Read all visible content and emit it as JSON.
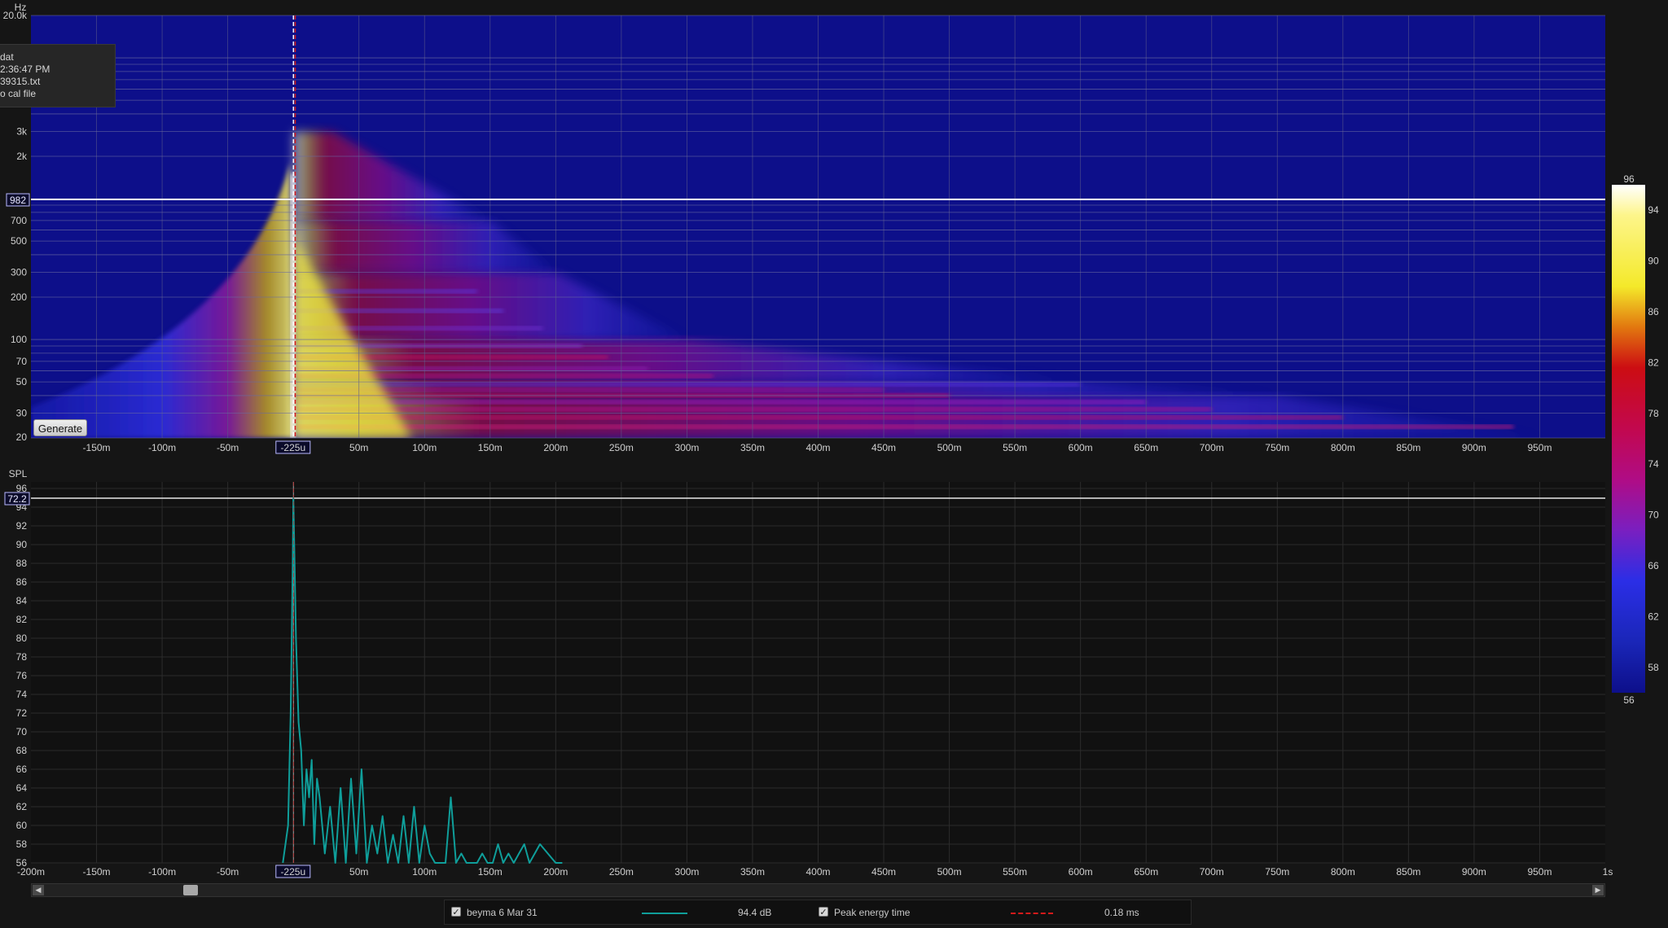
{
  "spectrogram": {
    "unit_label": "Hz",
    "freq_ticks": [
      "20.0k",
      "3k",
      "2k",
      "700",
      "500",
      "300",
      "200",
      "100",
      "70",
      "50",
      "30",
      "20"
    ],
    "freq_ticks_hz": [
      20000,
      3000,
      2000,
      700,
      500,
      300,
      200,
      100,
      70,
      50,
      30,
      20
    ],
    "cursor_freq_label": "982",
    "cursor_freq_hz": 982,
    "time_ticks": [
      "-150m",
      "-100m",
      "-50m",
      "-225u",
      "50m",
      "100m",
      "150m",
      "200m",
      "250m",
      "300m",
      "350m",
      "400m",
      "450m",
      "500m",
      "550m",
      "600m",
      "650m",
      "700m",
      "750m",
      "800m",
      "850m",
      "900m",
      "950m"
    ],
    "time_ticks_s": [
      -0.15,
      -0.1,
      -0.05,
      -0.000225,
      0.05,
      0.1,
      0.15,
      0.2,
      0.25,
      0.3,
      0.35,
      0.4,
      0.45,
      0.5,
      0.55,
      0.6,
      0.65,
      0.7,
      0.75,
      0.8,
      0.85,
      0.9,
      0.95
    ],
    "time_range_s": [
      -0.2,
      1.0
    ],
    "freq_range_hz": [
      20,
      20000
    ],
    "generate_label": "Generate"
  },
  "info_box": {
    "lines": [
      "dat",
      "2:36:47 PM",
      "39315.txt",
      "o cal file"
    ]
  },
  "colorbar": {
    "labels": [
      "96",
      "94",
      "90",
      "86",
      "82",
      "78",
      "74",
      "70",
      "66",
      "62",
      "58",
      "56"
    ],
    "values": [
      96,
      94,
      90,
      86,
      82,
      78,
      74,
      70,
      66,
      62,
      58,
      56
    ],
    "colors": [
      "#ffffff",
      "#fdf58a",
      "#f4e92a",
      "#e2780f",
      "#cc0d12",
      "#c2084e",
      "#b00c85",
      "#7a1fc0",
      "#4a2ed8",
      "#2b2ee6",
      "#1a26b8",
      "#0d0f8a"
    ]
  },
  "spl_chart": {
    "unit_label": "SPL",
    "cursor_spl_label": "72.2",
    "cursor_spl": 95.1,
    "y_ticks": [
      "96",
      "94",
      "92",
      "90",
      "88",
      "86",
      "84",
      "82",
      "80",
      "78",
      "76",
      "74",
      "72",
      "70",
      "68",
      "66",
      "64",
      "62",
      "60",
      "58",
      "56"
    ],
    "x_ticks": [
      "-200m",
      "-150m",
      "-100m",
      "-50m",
      "-225u",
      "50m",
      "100m",
      "150m",
      "200m",
      "250m",
      "300m",
      "350m",
      "400m",
      "450m",
      "500m",
      "550m",
      "600m",
      "650m",
      "700m",
      "750m",
      "800m",
      "850m",
      "900m",
      "950m",
      "1s"
    ]
  },
  "legend": {
    "series_name": "beyma 6 Mar 31",
    "series_value": "94.4 dB",
    "marker_name": "Peak energy time",
    "marker_value": "0.18 ms",
    "series_color": "#0f9e9a",
    "marker_color": "#d41a1a"
  },
  "chart_data": [
    {
      "type": "heatmap",
      "title": "",
      "xlabel": "",
      "ylabel": "Hz",
      "x_range_s": [
        -0.2,
        1.0
      ],
      "y_range_hz": [
        20,
        20000
      ],
      "y_scale": "log",
      "color_scale_db": [
        56,
        96
      ],
      "cursor": {
        "time": "-225u",
        "frequency_hz": 982
      },
      "energy_ridge": [
        {
          "freq_hz": 20,
          "decay_end_s": 0.95
        },
        {
          "freq_hz": 40,
          "decay_end_s": 0.75
        },
        {
          "freq_hz": 50,
          "decay_end_s": 0.6
        },
        {
          "freq_hz": 100,
          "decay_end_s": 0.3
        },
        {
          "freq_hz": 300,
          "decay_end_s": 0.2
        },
        {
          "freq_hz": 700,
          "decay_end_s": 0.15
        },
        {
          "freq_hz": 3000,
          "decay_end_s": 0.03
        }
      ]
    },
    {
      "type": "line",
      "title": "",
      "xlabel": "",
      "ylabel": "SPL",
      "ylim": [
        56,
        96
      ],
      "x_range_s": [
        -0.2,
        1.0
      ],
      "series": [
        {
          "name": "beyma 6 Mar 31",
          "x": [
            -0.008,
            -0.004,
            -0.002,
            -0.0005,
            0.0,
            0.002,
            0.004,
            0.006,
            0.008,
            0.01,
            0.012,
            0.014,
            0.016,
            0.018,
            0.02,
            0.024,
            0.028,
            0.032,
            0.036,
            0.04,
            0.044,
            0.048,
            0.052,
            0.056,
            0.06,
            0.064,
            0.068,
            0.072,
            0.076,
            0.08,
            0.084,
            0.088,
            0.092,
            0.096,
            0.1,
            0.104,
            0.108,
            0.112,
            0.116,
            0.12,
            0.124,
            0.128,
            0.132,
            0.136,
            0.14,
            0.144,
            0.148,
            0.152,
            0.156,
            0.16,
            0.164,
            0.168,
            0.172,
            0.176,
            0.18,
            0.184,
            0.188,
            0.2,
            0.205
          ],
          "values": [
            56,
            60,
            72,
            88,
            95,
            80,
            71,
            68,
            60,
            66,
            63,
            67,
            58,
            65,
            63,
            57,
            62,
            56,
            64,
            56,
            65,
            57,
            66,
            56,
            60,
            57,
            61,
            56,
            59,
            56,
            61,
            56,
            62,
            56,
            60,
            57,
            56,
            56,
            56,
            63,
            56,
            57,
            56,
            56,
            56,
            57,
            56,
            56,
            58,
            56,
            57,
            56,
            57,
            58,
            56,
            57,
            58,
            56,
            56
          ]
        }
      ],
      "markers": [
        {
          "name": "Peak energy time",
          "value": "0.18 ms"
        }
      ]
    }
  ]
}
